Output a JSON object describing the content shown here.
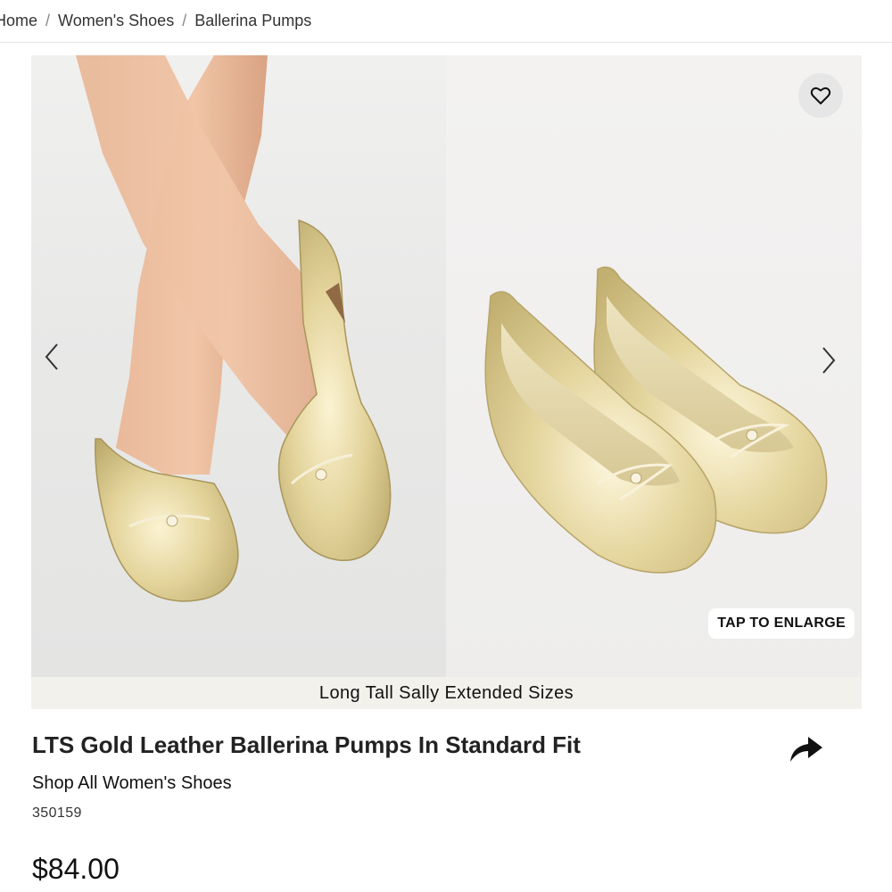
{
  "breadcrumb": {
    "items": [
      "Home",
      "Women's Shoes",
      "Ballerina Pumps"
    ],
    "separator": "/"
  },
  "gallery": {
    "enlarge_label": "TAP TO ENLARGE",
    "icons": {
      "wishlist": "heart-icon",
      "prev": "chevron-left-icon",
      "next": "chevron-right-icon"
    },
    "images": [
      {
        "name": "model-wearing-gold-ballerina-pumps"
      },
      {
        "name": "gold-ballerina-pumps-pair"
      }
    ]
  },
  "banner": {
    "text": "Long Tall Sally Extended Sizes"
  },
  "product": {
    "title": "LTS Gold Leather Ballerina Pumps In Standard Fit",
    "shop_all_link": "Shop All Women's Shoes",
    "sku": "350159",
    "price": "$84.00",
    "share_icon": "share-arrow-icon"
  },
  "colors": {
    "banner_bg": "#f3f1ec",
    "gold": "#d9c98f",
    "text": "#222222"
  }
}
